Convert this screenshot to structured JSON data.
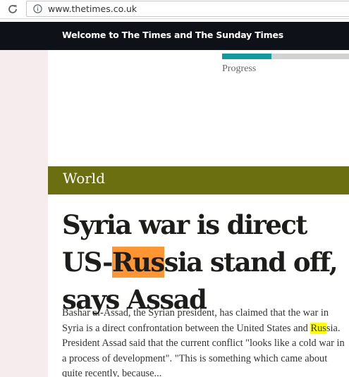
{
  "browser": {
    "url": "www.thetimes.co.uk",
    "reload_icon": "reload-icon",
    "info_icon": "info-icon"
  },
  "banner": {
    "text": "Welcome to The Times and The Sunday Times",
    "background": "#0f1118"
  },
  "progress": {
    "label": "Progress",
    "value": 0.39,
    "fill_color": "#0e9aa0",
    "track_color": "#d2d2d2"
  },
  "section": {
    "label": "World",
    "color": "#6b6f10"
  },
  "article": {
    "headline_part1": "Syria war is direct US-",
    "headline_highlight": "Rus",
    "headline_part2": "sia stand off, says Assad",
    "summary_part1": "Bashar al-Assad, the Syrian president, has claimed that the war in Syria is a direct confrontation between the United States and ",
    "summary_highlight": "Rus",
    "summary_part2": "sia. President Assad said that the current conflict \"looks like a cold war in a process of development\". \"This is something which came about quite recently, because...",
    "highlight_current_color": "#ff9632",
    "highlight_match_color": "#ffff00"
  }
}
